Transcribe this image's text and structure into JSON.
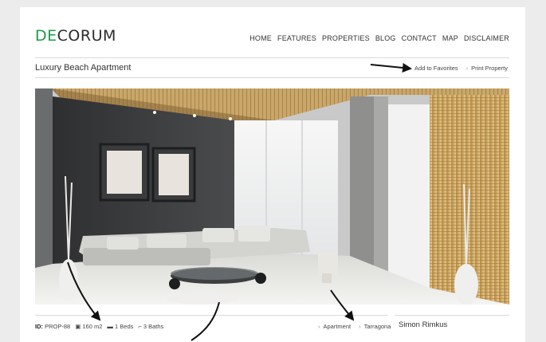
{
  "brand": {
    "logo_accent": "DE",
    "logo_rest": "CORUM",
    "accent_color": "#1f9a4a"
  },
  "nav": {
    "items": [
      "HOME",
      "FEATURES",
      "PROPERTIES",
      "BLOG",
      "CONTACT",
      "MAP",
      "DISCLAIMER"
    ]
  },
  "property": {
    "title": "Luxury Beach Apartment",
    "add_favorites": "Add to Favorites",
    "print": "Print Property",
    "id_label": "ID:",
    "id_value": "PROP-88",
    "area": "160 m2",
    "beds": "1 Beds",
    "baths": "3 Baths",
    "type": "Apartment",
    "city": "Tarragona"
  },
  "agent": {
    "name": "Simon Rimkus"
  },
  "icons": {
    "chevron": "chevron-right-icon",
    "area": "area-icon",
    "beds": "bed-icon",
    "baths": "bath-icon"
  }
}
